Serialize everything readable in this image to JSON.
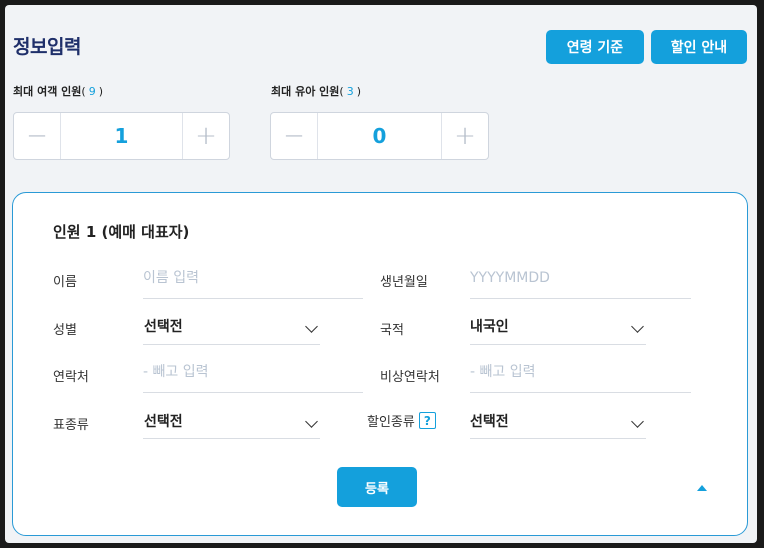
{
  "header": {
    "title": "정보입력",
    "age_button": "연령 기준",
    "discount_button": "할인 안내"
  },
  "counters": {
    "adult": {
      "label": "최대 여객 인원",
      "max": "9",
      "value": "1",
      "minus": "−",
      "plus": "+"
    },
    "infant": {
      "label": "최대 유아 인원",
      "max": "3",
      "value": "0",
      "minus": "−",
      "plus": "+"
    }
  },
  "passenger": {
    "title": "인원 1 (예매 대표자)",
    "fields": {
      "name": {
        "label": "이름",
        "placeholder": "이름 입력"
      },
      "birth": {
        "label": "생년월일",
        "placeholder": "YYYYMMDD"
      },
      "gender": {
        "label": "성별",
        "value": "선택전"
      },
      "nationality": {
        "label": "국적",
        "value": "내국인"
      },
      "phone": {
        "label": "연락처",
        "placeholder": "- 빼고 입력"
      },
      "emergency_phone": {
        "label": "비상연락처",
        "placeholder": "- 빼고 입력"
      },
      "ticket_type": {
        "label": "표종류",
        "value": "선택전"
      },
      "discount_type": {
        "label": "할인종류",
        "value": "선택전",
        "help": "?"
      }
    },
    "register_button": "등록"
  },
  "colors": {
    "accent": "#14a0dc",
    "title": "#1f2f6a",
    "background": "#f1f3f6"
  }
}
